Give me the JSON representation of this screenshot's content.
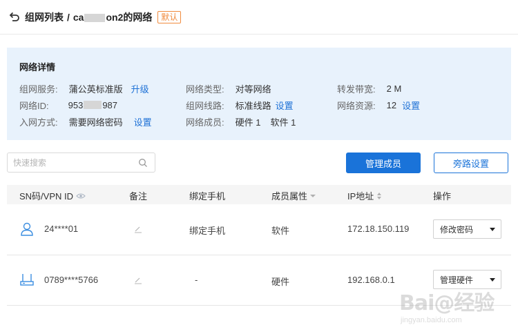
{
  "header": {
    "breadcrumb_list": "组网列表",
    "separator": "/",
    "network_name_prefix": "ca",
    "network_name_suffix": "on2的网络",
    "default_badge": "默认"
  },
  "details": {
    "title": "网络详情",
    "service_label": "组网服务:",
    "service_value": "蒲公英标准版",
    "upgrade_link": "升级",
    "network_id_label": "网络ID:",
    "network_id_prefix": "953",
    "network_id_suffix": "987",
    "join_label": "入网方式:",
    "join_value": "需要网络密码",
    "join_link": "设置",
    "type_label": "网络类型:",
    "type_value": "对等网络",
    "line_label": "组网线路:",
    "line_value": "标准线路",
    "line_link": "设置",
    "members_label": "网络成员:",
    "members_hw": "硬件 1",
    "members_sw": "软件 1",
    "bandwidth_label": "转发带宽:",
    "bandwidth_value": "2 M",
    "resource_label": "网络资源:",
    "resource_value": "12",
    "resource_link": "设置"
  },
  "toolbar": {
    "search_placeholder": "快速搜索",
    "manage_members": "管理成员",
    "bypass_settings": "旁路设置"
  },
  "table": {
    "columns": [
      "SN码/VPN ID",
      "备注",
      "绑定手机",
      "成员属性",
      "IP地址",
      "操作"
    ],
    "rows": [
      {
        "device_icon": "user-icon",
        "id": "24****01",
        "phone": "绑定手机",
        "attribute": "软件",
        "ip": "172.18.150.119",
        "action": "修改密码"
      },
      {
        "device_icon": "router-icon",
        "id": "0789****5766",
        "phone": "-",
        "attribute": "硬件",
        "ip": "192.168.0.1",
        "action": "管理硬件"
      }
    ]
  },
  "watermark": {
    "text": "Bai@经验",
    "sub": "jingyan.baidu.com"
  },
  "colors": {
    "accent": "#1a73d9",
    "panel_bg": "#e8f2fc",
    "badge": "#f08a3c"
  }
}
